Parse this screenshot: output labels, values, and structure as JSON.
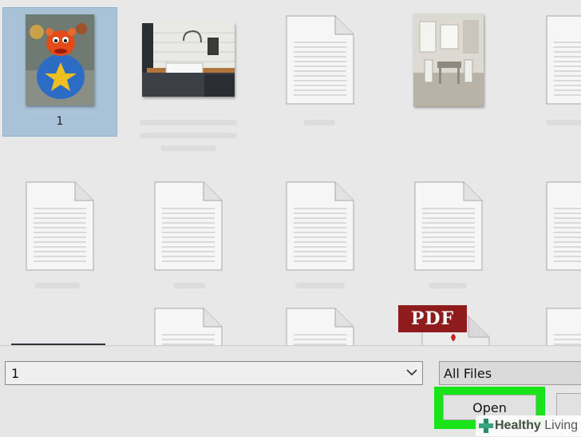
{
  "files": [
    {
      "id": "1",
      "kind": "photo-toy",
      "name": "1",
      "selected": true
    },
    {
      "id": "2",
      "kind": "photo-kitchen",
      "name": "",
      "selected": false
    },
    {
      "id": "3",
      "kind": "document",
      "name": "",
      "selected": false
    },
    {
      "id": "4",
      "kind": "photo-room",
      "name": "",
      "selected": false
    },
    {
      "id": "5",
      "kind": "document",
      "name": "",
      "selected": false
    },
    {
      "id": "6",
      "kind": "document",
      "name": "",
      "selected": false
    },
    {
      "id": "7",
      "kind": "document",
      "name": "",
      "selected": false
    },
    {
      "id": "8",
      "kind": "document",
      "name": "",
      "selected": false
    },
    {
      "id": "9",
      "kind": "document",
      "name": "",
      "selected": false
    },
    {
      "id": "10",
      "kind": "document",
      "name": "",
      "selected": false
    },
    {
      "id": "11",
      "kind": "photo-dark",
      "name": "",
      "selected": false
    },
    {
      "id": "12",
      "kind": "document",
      "name": "",
      "selected": false
    },
    {
      "id": "13",
      "kind": "document",
      "name": "",
      "selected": false
    },
    {
      "id": "14",
      "kind": "pdf",
      "name": "",
      "selected": false
    },
    {
      "id": "15",
      "kind": "document",
      "name": "",
      "selected": false
    }
  ],
  "pdf_badge": "PDF",
  "filename_field": {
    "value": "1",
    "icon": "chevron-down-icon"
  },
  "filetype_select": {
    "value": "All Files"
  },
  "buttons": {
    "open_label": "Open"
  },
  "colors": {
    "highlight": "#19e319",
    "selection": "#a9c2d8"
  },
  "watermark": {
    "text_bold": "Healthy",
    "text_light": " Living",
    "icon": "plus-cross-icon"
  }
}
